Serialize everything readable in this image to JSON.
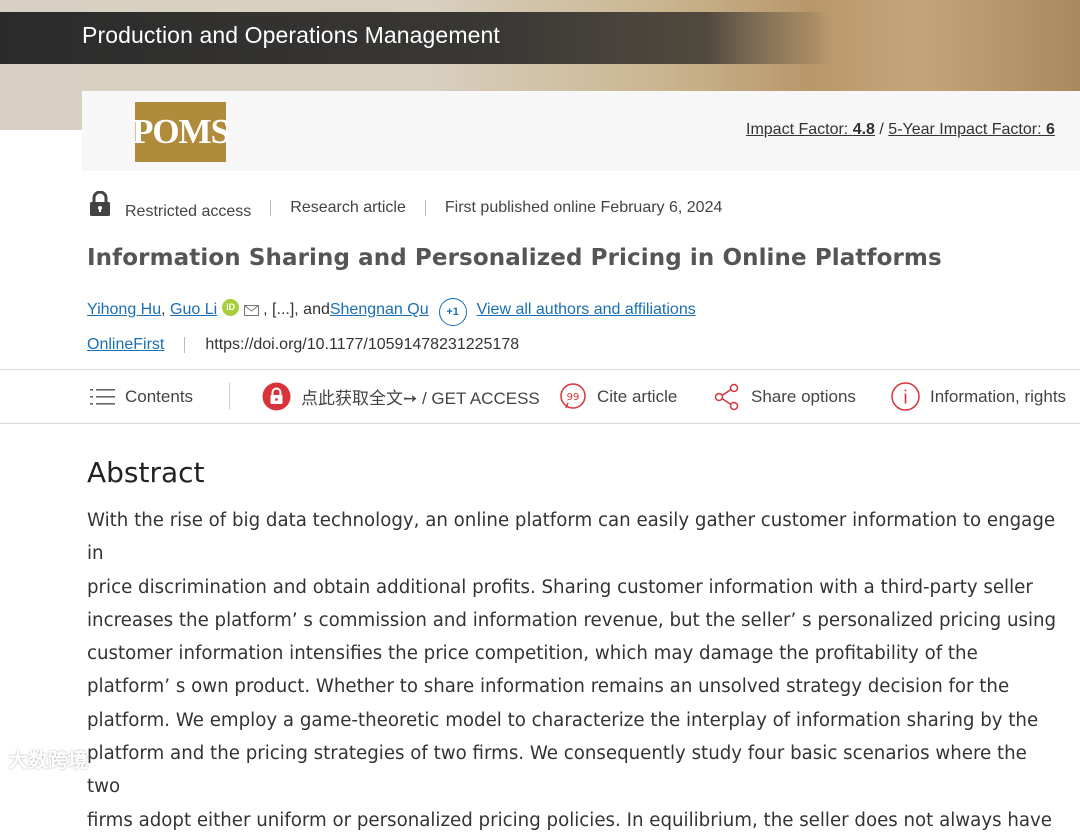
{
  "banner": {
    "journal_title": "Production and Operations Management"
  },
  "header": {
    "logo_text": "POMS",
    "impact_label": "Impact Factor: ",
    "impact_value": "4.8",
    "impact_sep": " / ",
    "five_year_label": "5-Year Impact Factor: ",
    "five_year_value": "6"
  },
  "meta": {
    "access": "Restricted access",
    "type": "Research article",
    "published": "First published online February 6, 2024"
  },
  "article": {
    "title": "Information Sharing and Personalized Pricing in Online Platforms",
    "author1": "Yihong Hu",
    "author2": "Guo Li",
    "orcid": "iD",
    "ellipsis": ", [...], and ",
    "author3": "Shengnan Qu",
    "more_count": "+1",
    "view_all": "View all authors and affiliations",
    "status": "OnlineFirst",
    "doi": "https://doi.org/10.1177/10591478231225178"
  },
  "toolbar": {
    "contents": "Contents",
    "get_access": "点此获取全文➙ / GET ACCESS",
    "cite": "Cite article",
    "share": "Share options",
    "info": "Information, rights"
  },
  "abstract": {
    "heading": "Abstract",
    "lines": [
      "With the rise of big data technology, an online platform can easily gather customer information to engage in",
      "price discrimination and obtain additional profits. Sharing customer information with a third-party seller",
      "increases the platform’ s commission and information revenue, but the seller’ s personalized pricing using",
      "customer information intensifies the price competition, which may damage the profitability of the",
      "platform’ s own product. Whether to share information remains an unsolved strategy decision for the",
      "platform. We employ a game-theoretic model to characterize the interplay of information sharing by the",
      "platform and the pricing strategies of two firms. We consequently study four basic scenarios where the two",
      "firms adopt either uniform or personalized pricing policies. In equilibrium, the seller does not always have"
    ]
  },
  "watermark": "大数跨境",
  "colors": {
    "accent": "#1a6fb5",
    "brand_gold": "#b08b3c",
    "access_red": "#d8333a"
  }
}
